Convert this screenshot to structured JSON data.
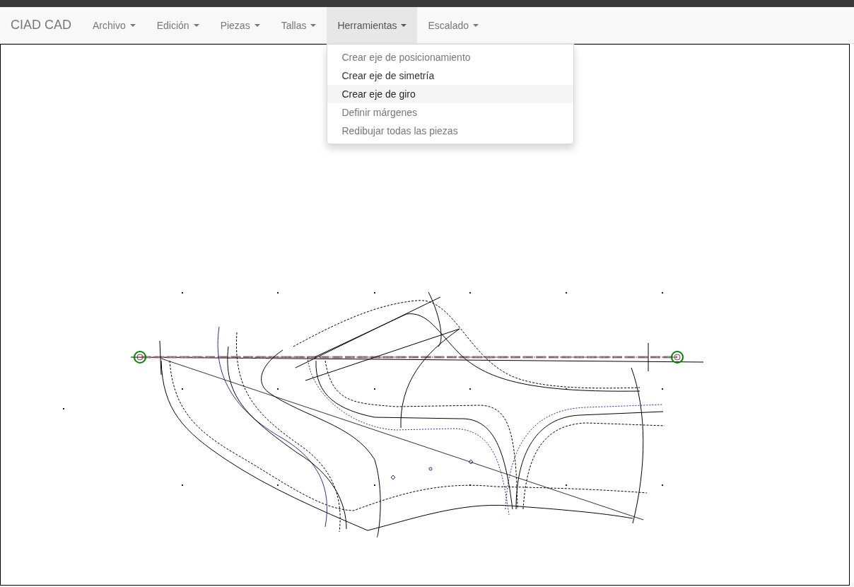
{
  "navbar": {
    "brand": "CIAD CAD",
    "menus": [
      {
        "label": "Archivo",
        "open": false
      },
      {
        "label": "Edición",
        "open": false
      },
      {
        "label": "Piezas",
        "open": false
      },
      {
        "label": "Tallas",
        "open": false
      },
      {
        "label": "Herramientas",
        "open": true,
        "items": [
          {
            "label": "Crear eje de posicionamiento",
            "disabled": true,
            "selected": false
          },
          {
            "label": "Crear eje de simetría",
            "disabled": false,
            "selected": false
          },
          {
            "label": "Crear eje de giro",
            "disabled": false,
            "selected": true
          },
          {
            "label": "Definir márgenes",
            "disabled": true,
            "selected": false
          },
          {
            "label": "Redibujar todas las piezas",
            "disabled": true,
            "selected": false
          }
        ]
      },
      {
        "label": "Escalado",
        "open": false
      }
    ]
  }
}
